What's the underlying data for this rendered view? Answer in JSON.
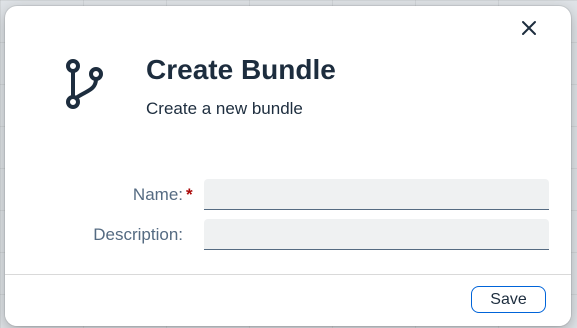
{
  "dialog": {
    "title": "Create Bundle",
    "subtitle": "Create a new bundle",
    "header_icon": "branch-icon",
    "close_icon": "close-icon"
  },
  "form": {
    "name": {
      "label": "Name:",
      "required_marker": "*",
      "value": "",
      "placeholder": ""
    },
    "description": {
      "label": "Description:",
      "value": "",
      "placeholder": ""
    }
  },
  "footer": {
    "save_label": "Save"
  },
  "colors": {
    "text": "#1d2d3e",
    "label": "#556b82",
    "required": "#aa0808",
    "accent": "#0064d9",
    "input_bg": "#eff1f2"
  }
}
